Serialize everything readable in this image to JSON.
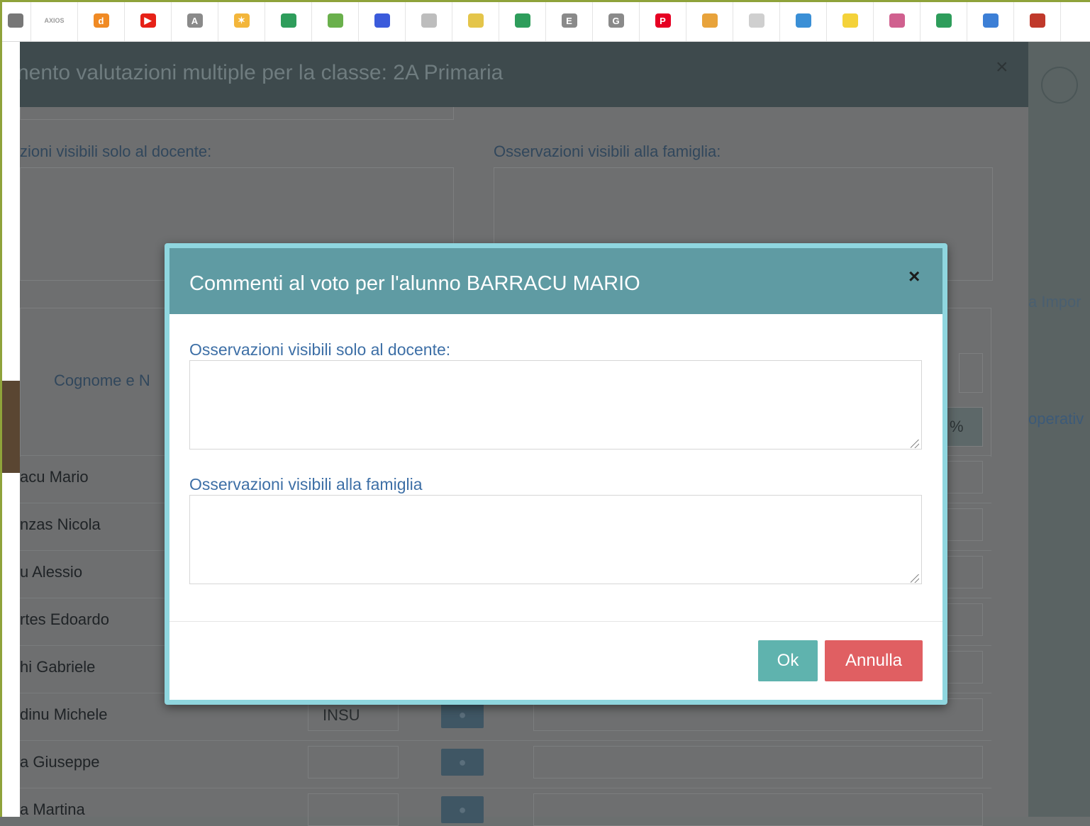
{
  "bookmarks": [
    {
      "icon": "partial-icon",
      "text": "",
      "color": "#777777"
    },
    {
      "icon": "axios-icon",
      "text": "AXIOS",
      "color": "#9b9b9b"
    },
    {
      "icon": "d-app-icon",
      "text": "d",
      "color": "#f08a24"
    },
    {
      "icon": "youtube-icon",
      "text": "▶",
      "color": "#e62117"
    },
    {
      "icon": "a-app-icon",
      "text": "A",
      "color": "#8a8a8a"
    },
    {
      "icon": "star-icon",
      "text": "✶",
      "color": "#f3b63b"
    },
    {
      "icon": "classroom-icon",
      "text": "",
      "color": "#2e9d5b"
    },
    {
      "icon": "emoji-icon",
      "text": "",
      "color": "#6ab04c"
    },
    {
      "icon": "shield-icon",
      "text": "",
      "color": "#3b5bdb"
    },
    {
      "icon": "panda-icon",
      "text": "",
      "color": "#bdbdbd"
    },
    {
      "icon": "tree-icon",
      "text": "",
      "color": "#e4c54a"
    },
    {
      "icon": "classroom-icon",
      "text": "",
      "color": "#2e9d5b"
    },
    {
      "icon": "e-app-icon",
      "text": "E",
      "color": "#8a8a8a"
    },
    {
      "icon": "g-app-icon",
      "text": "G",
      "color": "#8a8a8a"
    },
    {
      "icon": "pinterest-icon",
      "text": "P",
      "color": "#e60023"
    },
    {
      "icon": "cartoon-icon",
      "text": "",
      "color": "#e8a33b"
    },
    {
      "icon": "sketch-icon",
      "text": "",
      "color": "#cfcfcf"
    },
    {
      "icon": "globe-icon",
      "text": "",
      "color": "#3a8fd6"
    },
    {
      "icon": "sun-icon",
      "text": "",
      "color": "#f4d23a"
    },
    {
      "icon": "flower-icon",
      "text": "",
      "color": "#d0608f"
    },
    {
      "icon": "classroom-icon",
      "text": "",
      "color": "#2e9d5b"
    },
    {
      "icon": "grid-icon",
      "text": "",
      "color": "#3c7fd6"
    },
    {
      "icon": "pencil-icon",
      "text": "",
      "color": "#c0392b"
    }
  ],
  "background": {
    "title": "nento valutazioni multiple per la classe: 2A Primaria",
    "close": "×",
    "label_teacher": "zioni visibili solo al docente:",
    "label_family": "Osservazioni visibili alla famiglia:",
    "column_name": "Cognome e N",
    "percent": "%",
    "right_fragment_1": "a Impor",
    "right_fragment_2": "operativ",
    "grade_insu": "INSU",
    "students": [
      "acu Mario",
      "nzas Nicola",
      "u Alessio",
      "rtes Edoardo",
      "hi Gabriele",
      "dinu Michele",
      "a Giuseppe",
      "a Martina"
    ]
  },
  "dialog": {
    "title": "Commenti al voto per l'alunno BARRACU MARIO",
    "close": "×",
    "label_teacher": "Osservazioni visibili solo al docente:",
    "teacher_value": "",
    "label_family": "Osservazioni visibili alla famiglia",
    "family_value": "",
    "ok_label": "Ok",
    "cancel_label": "Annulla"
  },
  "colors": {
    "dialog_header": "#5f9ba3",
    "label_blue": "#3d6fa6",
    "ok": "#5fb3ae",
    "cancel": "#e05f62"
  }
}
